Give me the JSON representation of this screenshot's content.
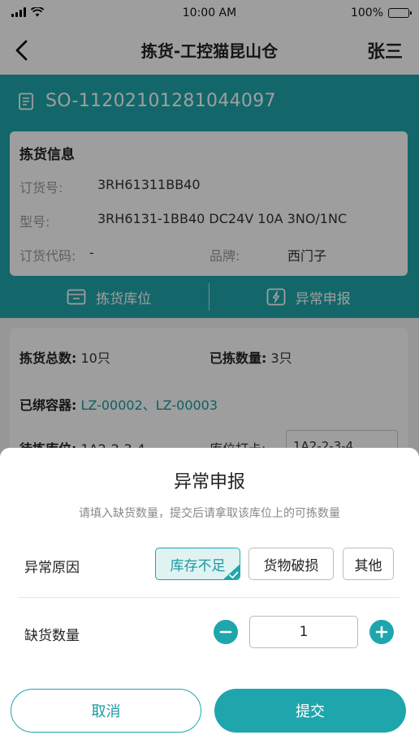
{
  "status_bar": {
    "time": "10:00 AM",
    "battery_percent": "100%",
    "battery_level": 1.0
  },
  "nav": {
    "title": "拣货-工控猫昆山仓",
    "user": "张三",
    "back_icon": "chevron-left-icon"
  },
  "order": {
    "number": "SO-11202101281044097",
    "icon": "document-icon"
  },
  "pick_info": {
    "title": "拣货信息",
    "order_no_label": "订货号:",
    "order_no_value": "3RH61311BB40",
    "model_label": "型号:",
    "model_value": "3RH6131-1BB40 DC24V 10A 3NO/1NC",
    "order_code_label": "订货代码:",
    "order_code_value": "-",
    "brand_label": "品牌:",
    "brand_value": "西门子"
  },
  "actions": [
    {
      "label": "拣货库位",
      "icon": "bin-icon"
    },
    {
      "label": "异常申报",
      "icon": "alert-icon"
    }
  ],
  "pick_detail": {
    "total_label": "拣货总数:",
    "total_value": "10只",
    "picked_label": "已拣数量:",
    "picked_value": "3只",
    "container_label": "已绑容器:",
    "container_value": "LZ-00002、LZ-00003",
    "location_label": "待拣库位:",
    "location_value": "1A2-2-3-4",
    "clock_label": "库位打卡:",
    "clock_value": "1A2-2-3-4"
  },
  "modal": {
    "title": "异常申报",
    "subtitle": "请填入缺货数量，提交后请拿取该库位上的可拣数量",
    "reason_label": "异常原因",
    "reasons": [
      {
        "label": "库存不足",
        "selected": true
      },
      {
        "label": "货物破损",
        "selected": false
      },
      {
        "label": "其他",
        "selected": false
      }
    ],
    "quantity_label": "缺货数量",
    "quantity_value": "1",
    "cancel_label": "取消",
    "submit_label": "提交"
  },
  "colors": {
    "accent": "#1fa6ac",
    "accent_text": "#1a9aa0",
    "selected_bg": "#dff3f3",
    "overlay": "rgba(0,0,0,0.38)"
  }
}
